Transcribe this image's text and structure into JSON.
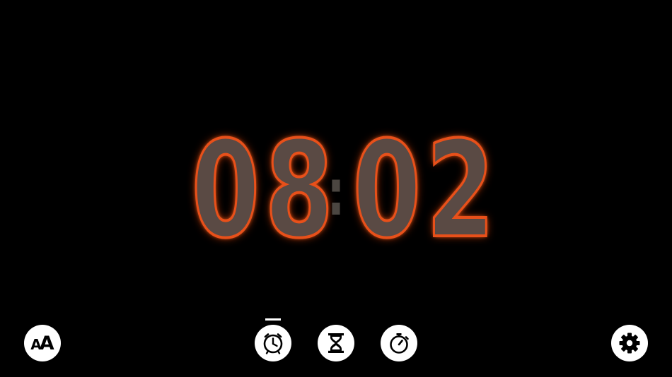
{
  "clock": {
    "hours_tens": "0",
    "hours_ones": "8",
    "separator": ":",
    "minutes_tens": "0",
    "minutes_ones": "2"
  },
  "toolbar": {
    "font_small": "A",
    "font_big": "A",
    "active_mode": "clock"
  },
  "icons": {
    "font": "font-size-icon",
    "clock": "clock-icon",
    "timer": "hourglass-icon",
    "stopwatch": "stopwatch-icon",
    "settings": "gear-icon"
  },
  "colors": {
    "background": "#000000",
    "button": "#ffffff",
    "digit_glow": "#e8501a",
    "digit_fill": "#5a4a44"
  }
}
